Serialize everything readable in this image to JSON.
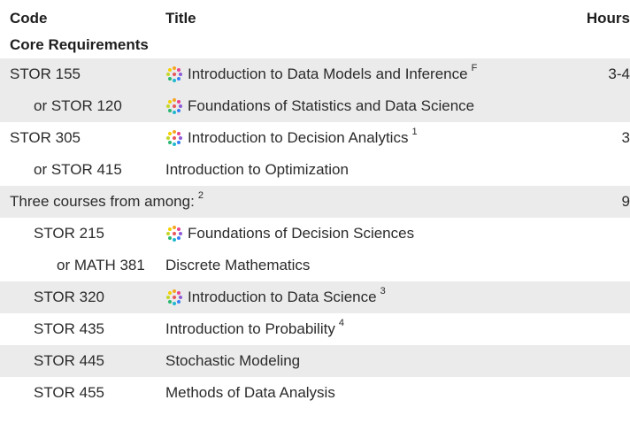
{
  "header": {
    "code": "Code",
    "title": "Title",
    "hours": "Hours"
  },
  "section_title": "Core Requirements",
  "rows": [
    {
      "code": "STOR 155",
      "title": "Introduction to Data Models and Inference",
      "sup": "F",
      "hours": "3-4",
      "icon": "sparkle-dots-icon"
    },
    {
      "code": "or STOR 120",
      "title": "Foundations of Statistics and Data Science",
      "sup": "",
      "hours": "",
      "icon": "sparkle-dots-icon"
    },
    {
      "code": "STOR 305",
      "title": "Introduction to Decision Analytics",
      "sup": "1",
      "hours": "3",
      "icon": "sparkle-dots-icon"
    },
    {
      "code": "or STOR 415",
      "title": "Introduction to Optimization",
      "sup": "",
      "hours": "",
      "icon": ""
    },
    {
      "code": "Three courses from among:",
      "title": "",
      "sup": "2",
      "hours": "9",
      "icon": ""
    },
    {
      "code": "STOR 215",
      "title": "Foundations of Decision Sciences",
      "sup": "",
      "hours": "",
      "icon": "sparkle-dots-icon"
    },
    {
      "code": "or MATH 381",
      "title": "Discrete Mathematics",
      "sup": "",
      "hours": "",
      "icon": ""
    },
    {
      "code": "STOR 320",
      "title": "Introduction to Data Science",
      "sup": "3",
      "hours": "",
      "icon": "sparkle-dots-icon"
    },
    {
      "code": "STOR 435",
      "title": "Introduction to Probability",
      "sup": "4",
      "hours": "",
      "icon": ""
    },
    {
      "code": "STOR 445",
      "title": "Stochastic Modeling",
      "sup": "",
      "hours": "",
      "icon": ""
    },
    {
      "code": "STOR 455",
      "title": "Methods of Data Analysis",
      "sup": "",
      "hours": "",
      "icon": ""
    }
  ]
}
